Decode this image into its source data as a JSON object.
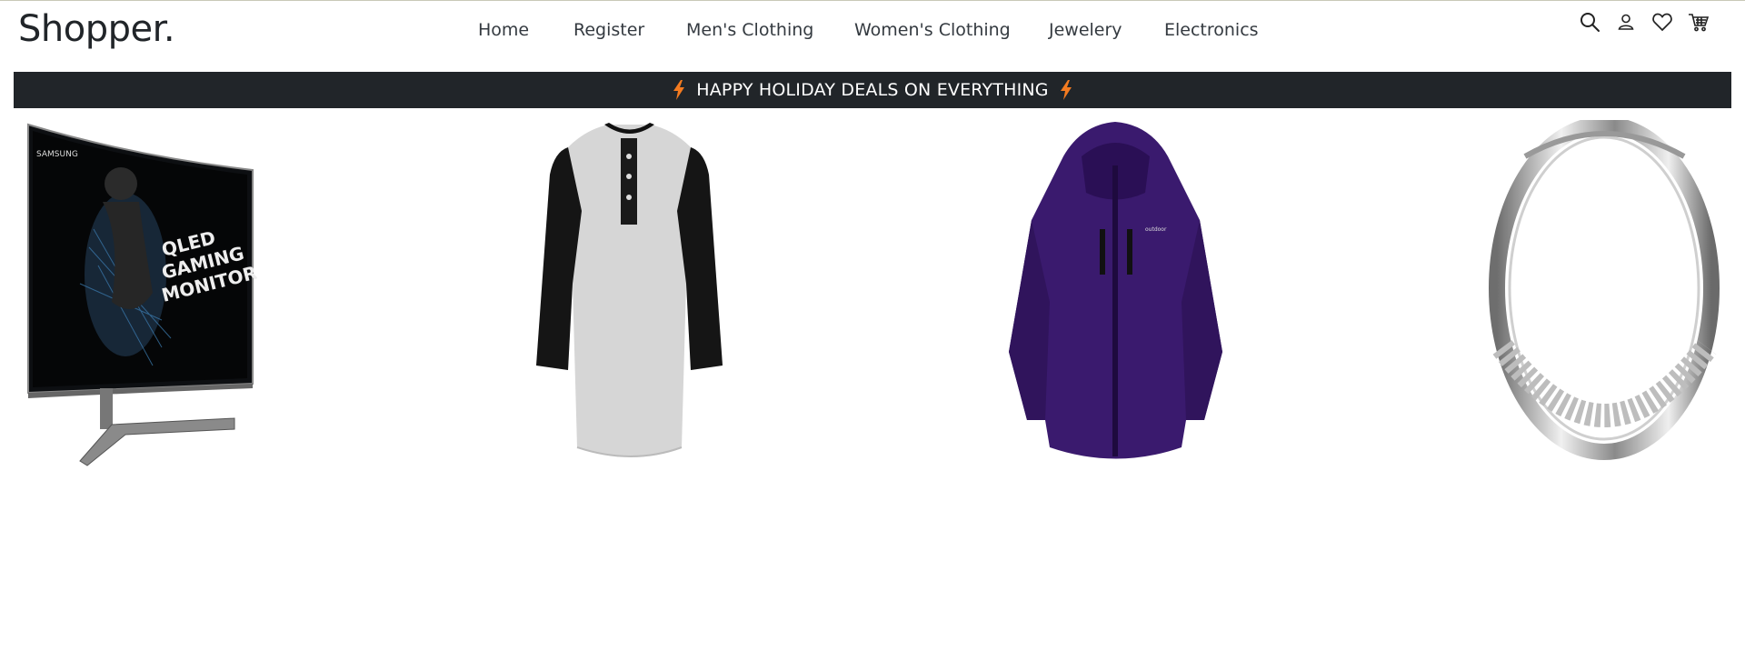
{
  "header": {
    "brand": "Shopper.",
    "nav": [
      {
        "label": "Home"
      },
      {
        "label": "Register"
      },
      {
        "label": "Men's Clothing"
      },
      {
        "label": "Women's Clothing"
      },
      {
        "label": "Jewelery"
      },
      {
        "label": "Electronics"
      }
    ],
    "icons": [
      "search-icon",
      "user-icon",
      "heart-icon",
      "cart-icon"
    ]
  },
  "banner": {
    "text": "HAPPY HOLIDAY DEALS ON EVERYTHING",
    "icon": "lightning-bolt-icon",
    "accent_color": "#f47b20",
    "background": "#212529"
  },
  "products": [
    {
      "image": "curved-gaming-monitor",
      "category": "Electronics",
      "image_text": [
        "SAMSUNG",
        "QLED",
        "GAMING",
        "MONITOR"
      ]
    },
    {
      "image": "raglan-henley-shirt",
      "category": "Men's Clothing"
    },
    {
      "image": "purple-winter-jacket",
      "category": "Women's Clothing"
    },
    {
      "image": "silver-ring",
      "category": "Jewelery"
    }
  ]
}
